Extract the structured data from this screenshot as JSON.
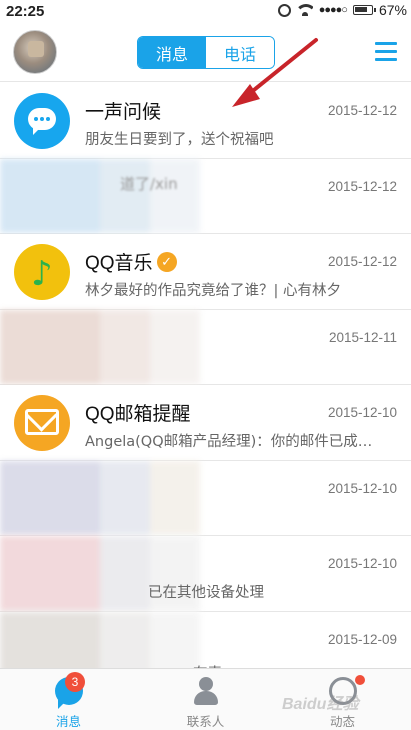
{
  "status_bar": {
    "time": "22:25",
    "battery": "67%"
  },
  "header": {
    "tabs": [
      {
        "label": "消息",
        "active": true
      },
      {
        "label": "电话",
        "active": false
      }
    ],
    "accent_color": "#1aa3e8"
  },
  "conversations": [
    {
      "name": "一声问候",
      "preview": "朋友生日要到了，送个祝福吧",
      "date": "2015-12-12",
      "icon": "chat-bubble-icon"
    },
    {
      "name": "",
      "preview": "",
      "date": "2015-12-12",
      "icon": "blurred",
      "partial_text": "道了/xin"
    },
    {
      "name": "QQ音乐",
      "preview": "林夕最好的作品究竟给了谁？| 心有林夕",
      "date": "2015-12-12",
      "icon": "music-note-icon",
      "verified": true
    },
    {
      "name": "",
      "preview": "",
      "date": "2015-12-11",
      "icon": "blurred"
    },
    {
      "name": "QQ邮箱提醒",
      "preview": "Angela(QQ邮箱产品经理)：你的邮件已成…",
      "date": "2015-12-10",
      "icon": "envelope-icon"
    },
    {
      "name": "",
      "preview": "",
      "date": "2015-12-10",
      "icon": "blurred"
    },
    {
      "name": "",
      "preview": "已在其他设备处理",
      "date": "2015-12-10",
      "icon": "blurred"
    },
    {
      "name": "",
      "preview": "有毒",
      "date": "2015-12-09",
      "icon": "blurred"
    }
  ],
  "tabbar": {
    "tabs": [
      {
        "label": "消息",
        "active": true,
        "badge": "3"
      },
      {
        "label": "联系人",
        "active": false
      },
      {
        "label": "动态",
        "active": false
      }
    ]
  },
  "watermark": "Baidu经验"
}
